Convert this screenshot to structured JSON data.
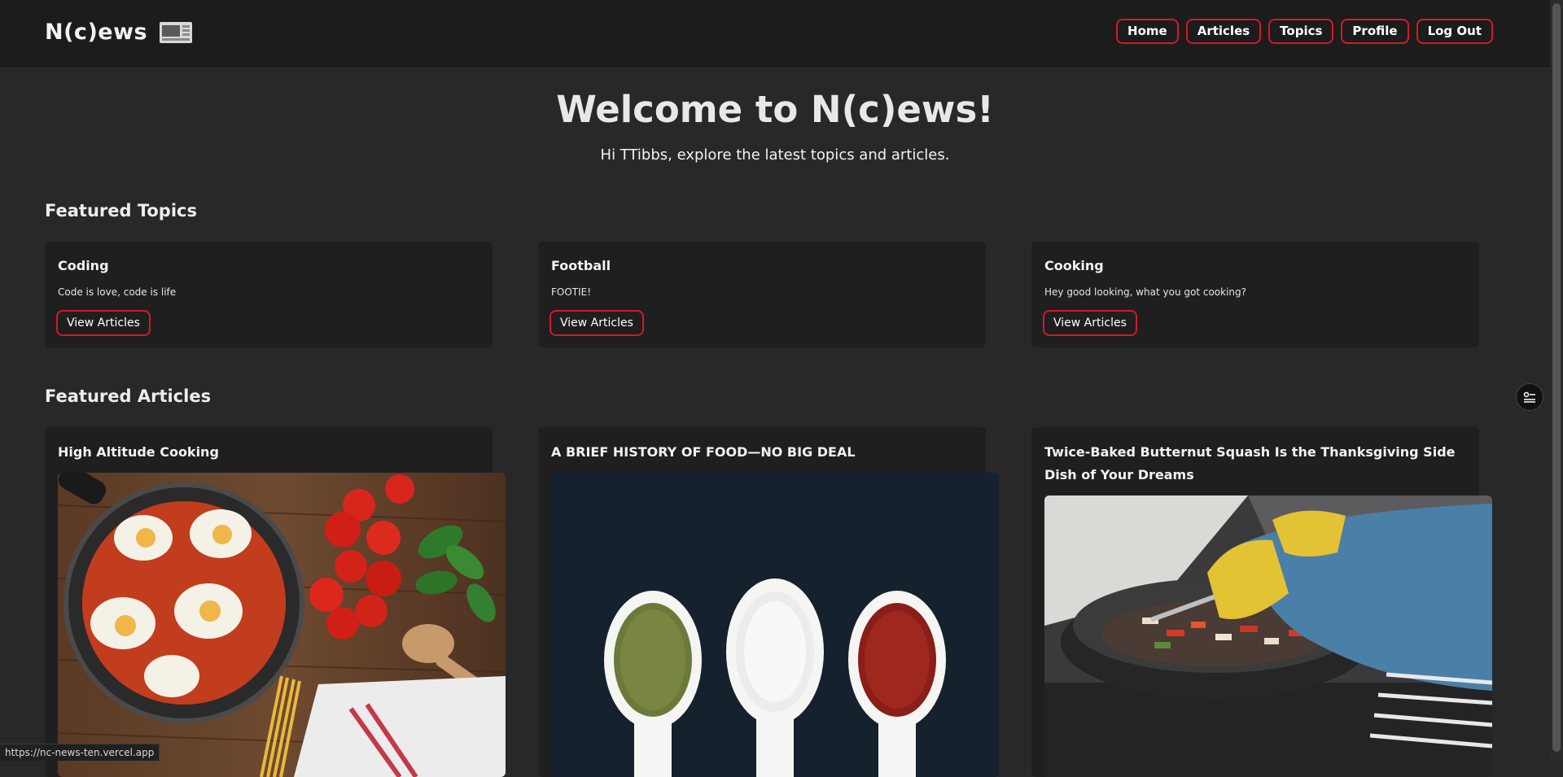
{
  "header": {
    "logo_text": "N(c)ews",
    "logo_icon": "newspaper-icon",
    "nav": [
      {
        "label": "Home"
      },
      {
        "label": "Articles"
      },
      {
        "label": "Topics"
      },
      {
        "label": "Profile"
      },
      {
        "label": "Log Out"
      }
    ]
  },
  "hero": {
    "title": "Welcome to N(c)ews!",
    "subtitle": "Hi TTibbs, explore the latest topics and articles."
  },
  "featured_topics": {
    "heading": "Featured Topics",
    "items": [
      {
        "name": "Coding",
        "description": "Code is love, code is life",
        "button": "View Articles"
      },
      {
        "name": "Football",
        "description": "FOOTIE!",
        "button": "View Articles"
      },
      {
        "name": "Cooking",
        "description": "Hey good looking, what you got cooking?",
        "button": "View Articles"
      }
    ]
  },
  "featured_articles": {
    "heading": "Featured Articles",
    "items": [
      {
        "title": "High Altitude Cooking",
        "image": "shakshuka-pan-photo"
      },
      {
        "title": "A BRIEF HISTORY OF FOOD—NO BIG DEAL",
        "image": "spice-spoons-photo"
      },
      {
        "title": "Twice-Baked Butternut Squash Is the Thanksgiving Side Dish of Your Dreams",
        "image": "wok-cooking-photo"
      }
    ]
  },
  "floating": {
    "icon": "settings-sliders-icon"
  },
  "status_bar": {
    "url": "https://nc-news-ten.vercel.app"
  },
  "colors": {
    "background": "#282828",
    "header": "#1c1c1c",
    "card": "#1f1f1f",
    "accent_red": "#d4192b",
    "text": "#f0f0f0"
  }
}
